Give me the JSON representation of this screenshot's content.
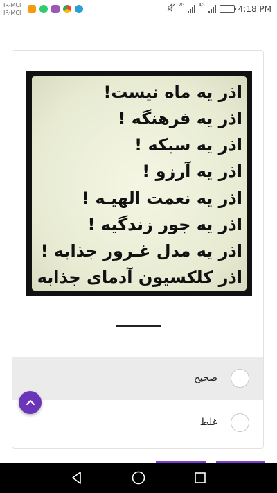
{
  "status_bar": {
    "carrier_1": "IR-MCI",
    "carrier_2": "IR-MCI",
    "network_1": "2G",
    "network_2": "4G",
    "time": "4:18 PM",
    "notification_icons": [
      "app-icon",
      "whatsapp-icon",
      "app-icon",
      "chrome-icon",
      "telegram-icon"
    ]
  },
  "question": {
    "image_lines": [
      "اذر یه ماه نیست!",
      "اذر یه فرهنگه !",
      "اذر یه سبکه !",
      "اذر یه آرزو !",
      "اذر یه نعمت الهیـه !",
      "اذر یه جور زندگیه !",
      "اذر یه مدل غـرور جذابه !",
      "اذر کلکسیون آدمای جذابه !"
    ]
  },
  "options": [
    {
      "label": "صحیح",
      "selected": false
    },
    {
      "label": "غلط",
      "selected": false
    }
  ],
  "colors": {
    "accent": "#6a35b8",
    "selected_row": "#ebebeb"
  }
}
